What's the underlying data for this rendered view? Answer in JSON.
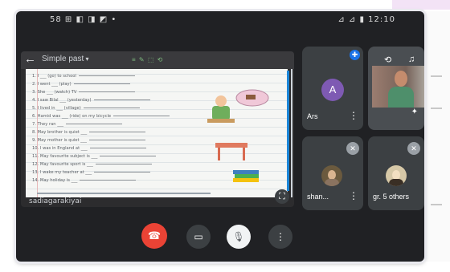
{
  "status_bar": {
    "left": "58 ⊞ ◧ ◨ ◩ •",
    "right": "⊿ ⊿ ▮ 12:10"
  },
  "screen_share": {
    "doc_title": "Simple past",
    "doc_tools": "≡ ✎ ⬚ ⟲",
    "footer": "sadiagarakiyai",
    "worksheet_lines": [
      "1. I ___ (go) to school",
      "2. I went ___ (play)",
      "3. She ___ (watch) TV",
      "4. I saw Bilal ___ (yesterday)",
      "5. I lived in ___ (village)",
      "6. Hamid was ___ (ride) on my bicycle",
      "7. They ran ___",
      "8. May brother is quiet ___",
      "9. May mother is quiet ___",
      "10. I was in England at ___",
      "11. May favourite subject is ___",
      "12. May favourite sport is ___",
      "13. I wake my teacher at ___",
      "14. May holiday is ___"
    ]
  },
  "participants": [
    {
      "name": "Ars",
      "initial": "A"
    },
    {
      "name": "shan..."
    },
    {
      "name": "gr. 5 others"
    }
  ],
  "colors": {
    "end_call": "#ea4335",
    "avatar_purple": "#7e5ab3",
    "pin_blue": "#1a73e8",
    "frame_bg": "#202124"
  },
  "icons": {
    "back": "arrow-left-icon",
    "expand": "fullscreen-icon",
    "end_call": "phone-hangup-icon",
    "camera": "video-camera-icon",
    "mic": "microphone-off-icon",
    "more": "more-vert-icon"
  }
}
